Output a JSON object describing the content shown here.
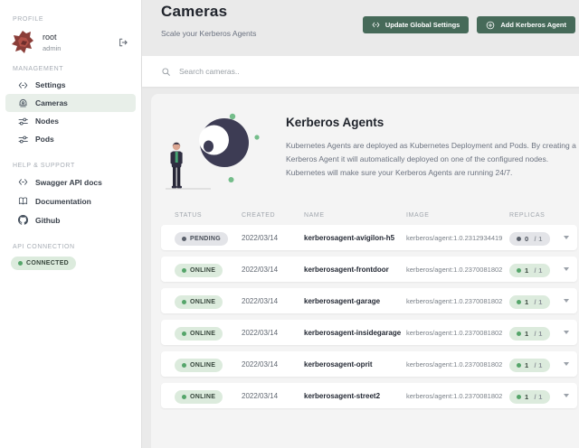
{
  "sidebar": {
    "profile_label": "PROFILE",
    "profile": {
      "name": "root",
      "role": "admin"
    },
    "management_label": "MANAGEMENT",
    "items": [
      {
        "label": "Settings"
      },
      {
        "label": "Cameras"
      },
      {
        "label": "Nodes"
      },
      {
        "label": "Pods"
      }
    ],
    "help_label": "HELP & SUPPORT",
    "help_items": [
      {
        "label": "Swagger API docs"
      },
      {
        "label": "Documentation"
      },
      {
        "label": "Github"
      }
    ],
    "api_label": "API CONNECTION",
    "api_status": "CONNECTED"
  },
  "page": {
    "title": "Cameras",
    "subtitle": "Scale your Kerberos Agents"
  },
  "header_buttons": {
    "update": "Update Global Settings",
    "add": "Add Kerberos Agent"
  },
  "search": {
    "placeholder": "Search cameras.."
  },
  "intro": {
    "title": "Kerberos Agents",
    "description": "Kubernetes Agents are deployed as Kubernetes Deployment and Pods. By creating a Kerberos Agent it will automatically deployed on one of the configured nodes. Kubernetes will make sure your Kerberos Agents are running 24/7."
  },
  "table": {
    "headers": [
      "STATUS",
      "CREATED",
      "NAME",
      "IMAGE",
      "REPLICAS"
    ],
    "rows": [
      {
        "status": "PENDING",
        "created": "2022/03/14",
        "name": "kerberosagent-avigilon-h5",
        "image": "kerberos/agent:1.0.2312934419",
        "replicas": "0",
        "replicas_total": "/ 1"
      },
      {
        "status": "ONLINE",
        "created": "2022/03/14",
        "name": "kerberosagent-frontdoor",
        "image": "kerberos/agent:1.0.2370081802",
        "replicas": "1",
        "replicas_total": "/ 1"
      },
      {
        "status": "ONLINE",
        "created": "2022/03/14",
        "name": "kerberosagent-garage",
        "image": "kerberos/agent:1.0.2370081802",
        "replicas": "1",
        "replicas_total": "/ 1"
      },
      {
        "status": "ONLINE",
        "created": "2022/03/14",
        "name": "kerberosagent-insidegarage",
        "image": "kerberos/agent:1.0.2370081802",
        "replicas": "1",
        "replicas_total": "/ 1"
      },
      {
        "status": "ONLINE",
        "created": "2022/03/14",
        "name": "kerberosagent-oprit",
        "image": "kerberos/agent:1.0.2370081802",
        "replicas": "1",
        "replicas_total": "/ 1"
      },
      {
        "status": "ONLINE",
        "created": "2022/03/14",
        "name": "kerberosagent-street2",
        "image": "kerberos/agent:1.0.2370081802",
        "replicas": "1",
        "replicas_total": "/ 1"
      }
    ]
  },
  "colors": {
    "accent_green": "#466a59",
    "badge_green_bg": "#dcebdd",
    "badge_green_dot": "#55a56a",
    "badge_gray_bg": "#e3e4e8",
    "badge_gray_dot": "#5a606b",
    "active_item_bg": "#e8efe9",
    "panel_bg": "#f4f4f4"
  }
}
